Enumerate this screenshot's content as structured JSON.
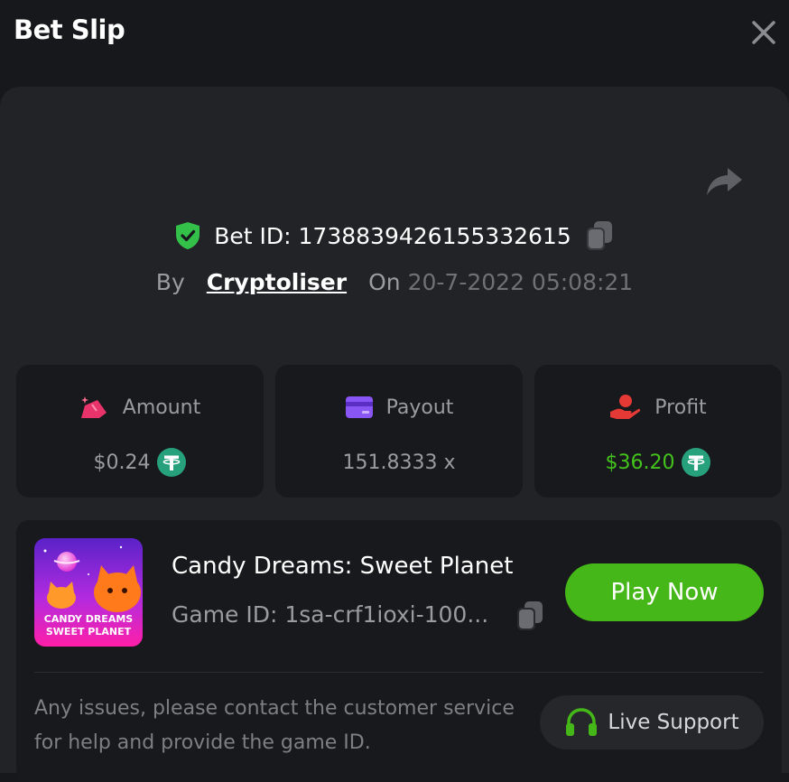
{
  "header": {
    "title": "Bet Slip",
    "close_icon": "close-icon"
  },
  "bet": {
    "id_text": "Bet ID: 1738839426155332615",
    "by_label": "By",
    "username": "Cryptoliser",
    "on_label": "On",
    "datetime": "20-7-2022 05:08:21"
  },
  "stats": [
    {
      "label": "Amount",
      "value": "$0.24",
      "icon": "amount-icon",
      "currency_icon": "tether-icon"
    },
    {
      "label": "Payout",
      "value": "151.8333 x",
      "icon": "card-icon"
    },
    {
      "label": "Profit",
      "value": "$36.20",
      "icon": "profit-hand-icon",
      "currency_icon": "tether-icon"
    }
  ],
  "game": {
    "name": "Candy Dreams: Sweet Planet",
    "id_text": "Game ID: 1sa-crf1ioxi-100...",
    "thumb_text_line1": "CANDY DREAMS",
    "thumb_text_line2": "SWEET PLANET",
    "play_label": "Play Now"
  },
  "support": {
    "notice": "Any issues, please contact the customer service for help and provide the game ID.",
    "button_label": "Live Support"
  },
  "colors": {
    "background": "#17181b",
    "panel": "#222326",
    "card": "#18191c",
    "accent_green": "#45b719",
    "tether": "#26a17b",
    "amount_icon": "#e8336b",
    "payout_icon": "#8a55f5",
    "profit_icon": "#e53935"
  }
}
